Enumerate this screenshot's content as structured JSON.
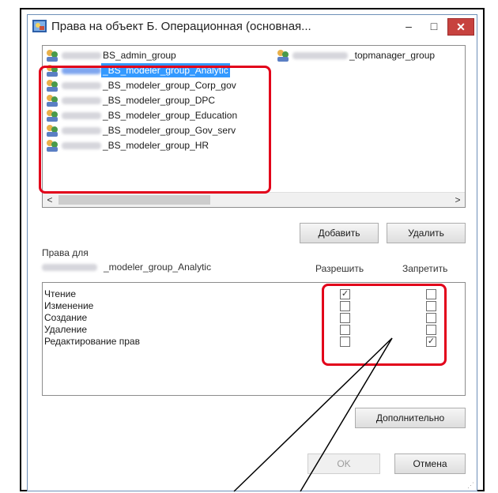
{
  "window": {
    "title": "Права на объект Б. Операционная (основная...",
    "minimize_glyph": "–",
    "maximize_glyph": "□",
    "close_glyph": "✕",
    "title_icon": "security-dialog-icon"
  },
  "groups": {
    "items": [
      {
        "label": "BS_admin_group",
        "selected": false
      },
      {
        "label": "_topmanager_group",
        "selected": false
      },
      {
        "label": "_BS_modeler_group_Analytic",
        "selected": true
      },
      {
        "label": "_BS_modeler_group_Corp_gov",
        "selected": false
      },
      {
        "label": "_BS_modeler_group_DPC",
        "selected": false
      },
      {
        "label": "_BS_modeler_group_Education",
        "selected": false
      },
      {
        "label": "_BS_modeler_group_Gov_serv",
        "selected": false
      },
      {
        "label": "_BS_modeler_group_HR",
        "selected": false
      }
    ],
    "scroll_left": "<",
    "scroll_right": ">"
  },
  "buttons": {
    "add": "Добавить",
    "remove": "Удалить",
    "advanced": "Дополнительно",
    "ok": "OK",
    "cancel": "Отмена"
  },
  "rights": {
    "for_label": "Права для",
    "principal": "_modeler_group_Analytic",
    "allow_header": "Разрешить",
    "deny_header": "Запретить",
    "rows": [
      {
        "name": "Чтение",
        "allow": true,
        "deny": false
      },
      {
        "name": "Изменение",
        "allow": false,
        "deny": false
      },
      {
        "name": "Создание",
        "allow": false,
        "deny": false
      },
      {
        "name": "Удаление",
        "allow": false,
        "deny": false
      },
      {
        "name": "Редактирование прав",
        "allow": false,
        "deny": true
      }
    ]
  },
  "colors": {
    "highlight": "#e2001a",
    "selection": "#3399ff"
  }
}
